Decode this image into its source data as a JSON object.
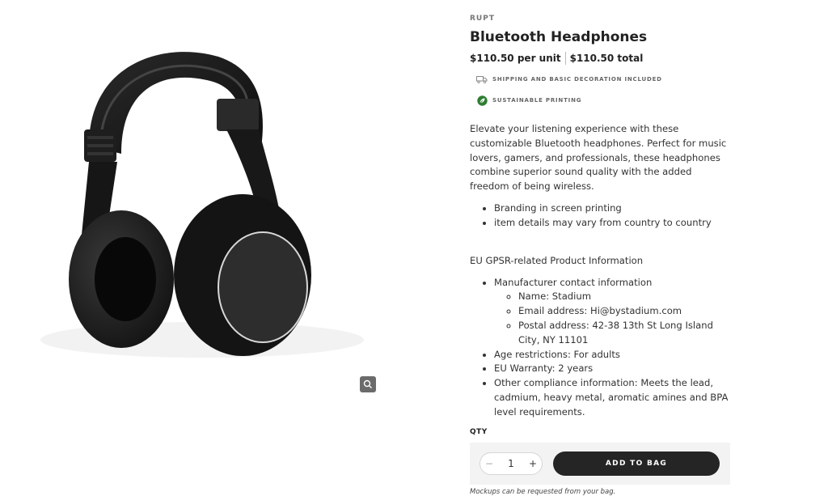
{
  "product": {
    "brand": "RUPT",
    "title": "Bluetooth Headphones",
    "price_per_unit": "$110.50 per unit",
    "price_total": "$110.50 total",
    "features": [
      {
        "label": "SHIPPING AND BASIC DECORATION INCLUDED",
        "icon": "truck-icon"
      },
      {
        "label": "SUSTAINABLE PRINTING",
        "icon": "leaf-icon",
        "color": "#2e7d32"
      }
    ],
    "description": "Elevate your listening experience with these customizable Bluetooth headphones. Perfect for music lovers, gamers, and professionals, these headphones combine superior sound quality with the added freedom of being wireless.",
    "bullets": [
      "Branding in screen printing",
      "item details may vary from country to country"
    ],
    "gpsr_title": "EU GPSR-related Product Information",
    "gpsr": {
      "manufacturer": "Manufacturer contact information",
      "manufacturer_details": [
        "Name: Stadium",
        "Email address: Hi@bystadium.com",
        "Postal address: 42-38 13th St Long Island City, NY 11101"
      ],
      "age": "Age restrictions: For adults",
      "warranty": "EU Warranty: 2 years",
      "compliance": "Other compliance information: Meets the lead, cadmium, heavy metal, aromatic amines and BPA level requirements."
    }
  },
  "purchase": {
    "qty_label": "QTY",
    "qty_value": "1",
    "minus": "−",
    "plus": "+",
    "add_to_bag": "ADD TO BAG",
    "note": "Mockups can be requested from your bag."
  },
  "gallery": {
    "image": "headphones-product-image",
    "zoom_icon": "magnifier-icon"
  }
}
